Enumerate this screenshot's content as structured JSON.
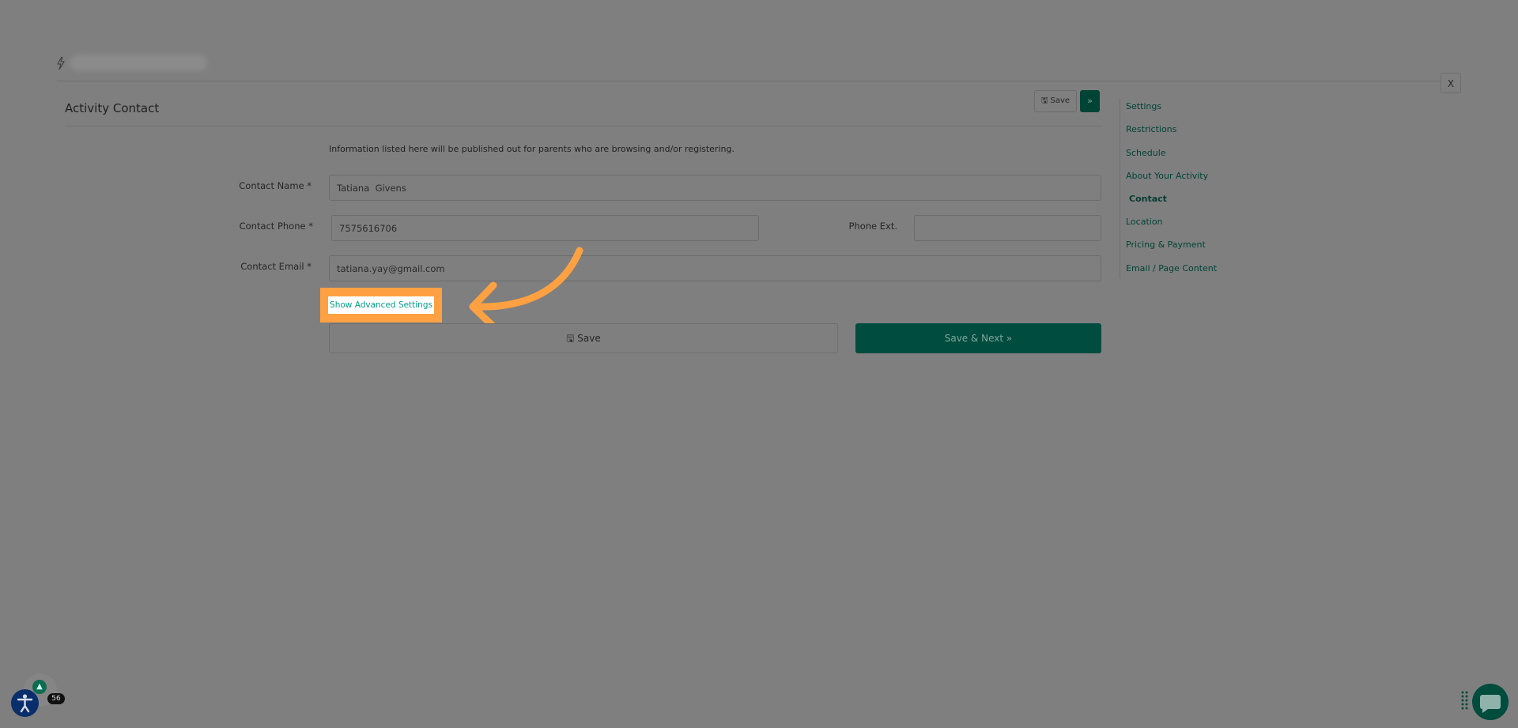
{
  "top": {
    "close_label": "X"
  },
  "header": {
    "title": "Activity Contact",
    "save_label": "Save",
    "next_label": "»"
  },
  "form": {
    "intro": "Information listed here will be published out for parents who are browsing and/or registering.",
    "contact_name_label": "Contact Name *",
    "contact_name_value": "Tatiana  Givens",
    "contact_phone_label": "Contact Phone *",
    "contact_phone_value": "7575616706",
    "phone_ext_label": "Phone Ext.",
    "phone_ext_value": "",
    "contact_email_label": "Contact Email *",
    "contact_email_value": "tatiana.yay@gmail.com",
    "advanced_link": "Show Advanced Settings",
    "save_label": "Save",
    "save_next_label": "Save & Next »"
  },
  "nav": {
    "items": [
      {
        "label": "Settings"
      },
      {
        "label": "Restrictions"
      },
      {
        "label": "Schedule"
      },
      {
        "label": "About Your Activity"
      },
      {
        "label": "Contact",
        "active": true
      },
      {
        "label": "Location"
      },
      {
        "label": "Pricing & Payment"
      },
      {
        "label": "Email / Page Content"
      }
    ]
  },
  "widgets": {
    "badge_count": "56"
  },
  "colors": {
    "overlay_bg": "#7f7f7f",
    "brand_green": "#004c3f",
    "highlight_orange": "#ffa142",
    "link_teal": "#00a08a"
  },
  "icons": [
    "bolt-icon",
    "save-disk-icon",
    "accessibility-icon",
    "chat-bubble-icon",
    "drag-grip-icon",
    "logo-icon"
  ]
}
